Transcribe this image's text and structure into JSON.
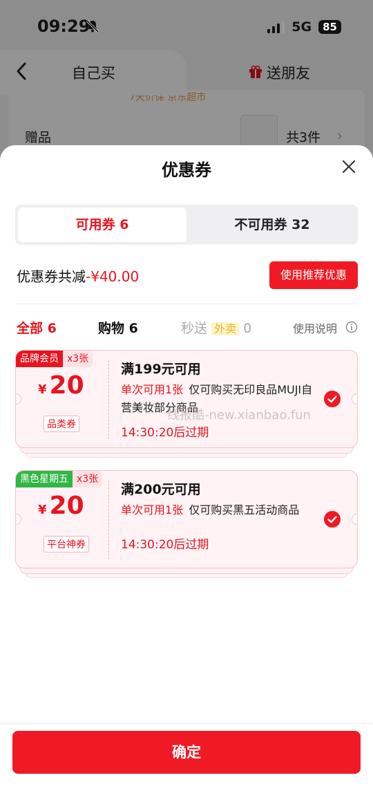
{
  "status_bar": {
    "time": "09:29",
    "network": "5G",
    "battery": "85"
  },
  "nav": {
    "self_label": "自己买",
    "friend_label": "送朋友"
  },
  "background": {
    "faded_text": "7天价保  京东超市",
    "gift_label": "赠品",
    "gift_count": "共3件",
    "chevron": "›"
  },
  "sheet": {
    "title": "优惠券",
    "tabs": {
      "available": "可用券 6",
      "unavailable": "不可用券 32"
    },
    "summary": {
      "label": "优惠券共减",
      "amount": "-¥40.00"
    },
    "recommend_button": "使用推荐优惠",
    "filters": {
      "all": "全部 6",
      "shopping": "购物 6",
      "flash_prefix": "秒送",
      "flash_tag": "外卖",
      "flash_count": "0",
      "help": "使用说明"
    },
    "coupons": [
      {
        "badge": "品牌会员",
        "badge_color": "#e8141f",
        "multiplier": "x3张",
        "currency": "¥",
        "value": "20",
        "type": "品类券",
        "condition": "满199元可用",
        "once": "单次可用1张",
        "scope": "仅可购买无印良品MUJI自营美妆部分商品",
        "expire": "14:30:20后过期",
        "selected": true
      },
      {
        "badge": "黑色星期五",
        "badge_color": "#2fb744",
        "multiplier": "x3张",
        "currency": "¥",
        "value": "20",
        "type": "平台神券",
        "condition": "满200元可用",
        "once": "单次可用1张",
        "scope": "仅可购买黑五活动商品",
        "expire": "14:30:20后过期",
        "selected": true
      }
    ],
    "watermark": "线报酷-new.xianbao.fun",
    "confirm_button": "确定"
  },
  "colors": {
    "accent": "#f01a24",
    "brand_red": "#e8141f"
  },
  "icons": [
    "bell-slash-icon",
    "back-icon",
    "gift-icon",
    "close-icon",
    "info-icon",
    "check-icon"
  ]
}
